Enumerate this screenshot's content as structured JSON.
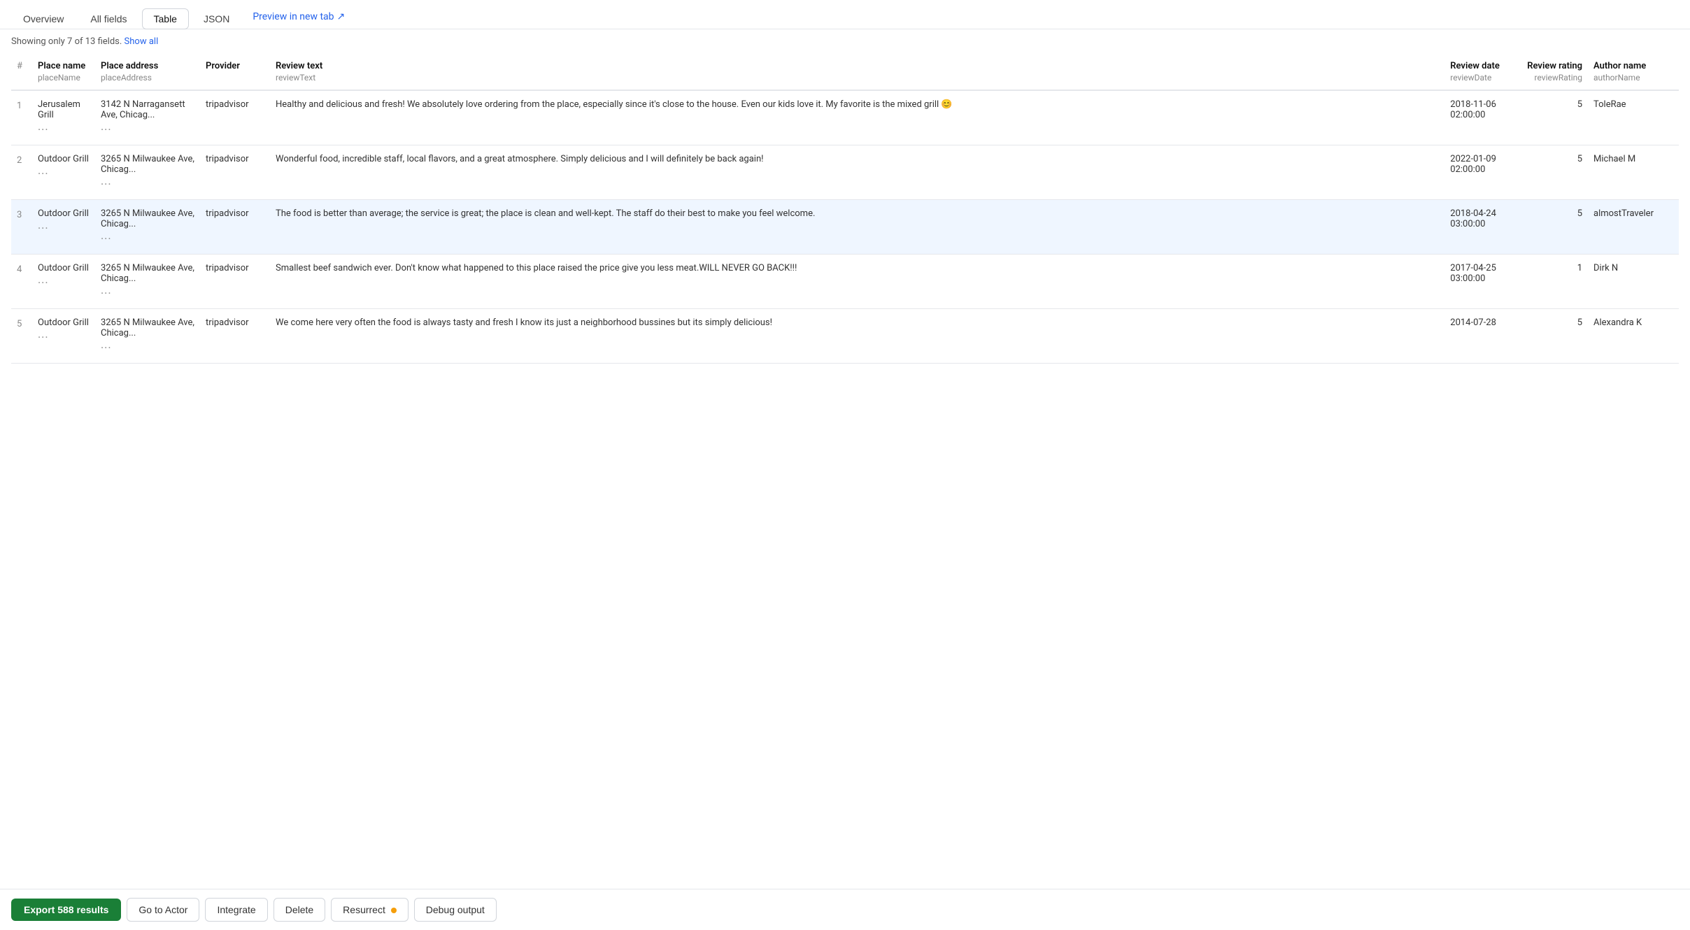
{
  "tabs": [
    {
      "id": "overview",
      "label": "Overview",
      "active": false
    },
    {
      "id": "all-fields",
      "label": "All fields",
      "active": false
    },
    {
      "id": "table",
      "label": "Table",
      "active": true
    },
    {
      "id": "json",
      "label": "JSON",
      "active": false
    }
  ],
  "preview_link": {
    "label": "Preview in new tab",
    "icon": "↗"
  },
  "fields_info": {
    "text": "Showing only 7 of 13 fields.",
    "show_all_label": "Show all"
  },
  "columns": [
    {
      "id": "num",
      "label": "#",
      "key": ""
    },
    {
      "id": "placeName",
      "label": "Place name",
      "key": "placeName"
    },
    {
      "id": "placeAddress",
      "label": "Place address",
      "key": "placeAddress"
    },
    {
      "id": "provider",
      "label": "Provider",
      "key": ""
    },
    {
      "id": "reviewText",
      "label": "Review text",
      "key": "reviewText"
    },
    {
      "id": "reviewDate",
      "label": "Review date",
      "key": "reviewDate"
    },
    {
      "id": "reviewRating",
      "label": "Review rating",
      "key": "reviewRating"
    },
    {
      "id": "authorName",
      "label": "Author name",
      "key": "authorName"
    }
  ],
  "rows": [
    {
      "num": 1,
      "placeName": "Jerusalem Grill",
      "placeAddress": "3142 N Narragansett Ave, Chicag...",
      "provider": "tripadvisor",
      "reviewText": "Healthy and delicious and fresh! We absolutely love ordering from the place, especially since it's close to the house. Even our kids love it. My favorite is the mixed grill 😊",
      "reviewDate": "2018-11-06 02:00:00",
      "reviewRating": "5",
      "authorName": "ToleRae",
      "highlighted": false
    },
    {
      "num": 2,
      "placeName": "Outdoor Grill",
      "placeAddress": "3265 N Milwaukee Ave, Chicag...",
      "provider": "tripadvisor",
      "reviewText": "Wonderful food, incredible staff, local flavors, and a great atmosphere. Simply delicious and I will definitely be back again!",
      "reviewDate": "2022-01-09 02:00:00",
      "reviewRating": "5",
      "authorName": "Michael M",
      "highlighted": false
    },
    {
      "num": 3,
      "placeName": "Outdoor Grill",
      "placeAddress": "3265 N Milwaukee Ave, Chicag...",
      "provider": "tripadvisor",
      "reviewText": "The food is better than average; the service is great; the place is clean and well-kept. The staff do their best to make you feel welcome.",
      "reviewDate": "2018-04-24 03:00:00",
      "reviewRating": "5",
      "authorName": "almostTraveler",
      "highlighted": true
    },
    {
      "num": 4,
      "placeName": "Outdoor Grill",
      "placeAddress": "3265 N Milwaukee Ave, Chicag...",
      "provider": "tripadvisor",
      "reviewText": "Smallest beef sandwich ever. Don't know what happened to this place raised the price give you less meat.WILL NEVER GO BACK!!!",
      "reviewDate": "2017-04-25 03:00:00",
      "reviewRating": "1",
      "authorName": "Dirk N",
      "highlighted": false
    },
    {
      "num": 5,
      "placeName": "Outdoor Grill",
      "placeAddress": "3265 N Milwaukee Ave, Chicag...",
      "provider": "tripadvisor",
      "reviewText": "We come here very often the food is always tasty and fresh I know its just a neighborhood bussines but its simply delicious!",
      "reviewDate": "2014-07-28",
      "reviewRating": "5",
      "authorName": "Alexandra K",
      "highlighted": false
    }
  ],
  "bottom_bar": {
    "export_label": "Export 588 results",
    "go_to_actor_label": "Go to Actor",
    "integrate_label": "Integrate",
    "delete_label": "Delete",
    "resurrect_label": "Resurrect",
    "debug_label": "Debug output"
  }
}
